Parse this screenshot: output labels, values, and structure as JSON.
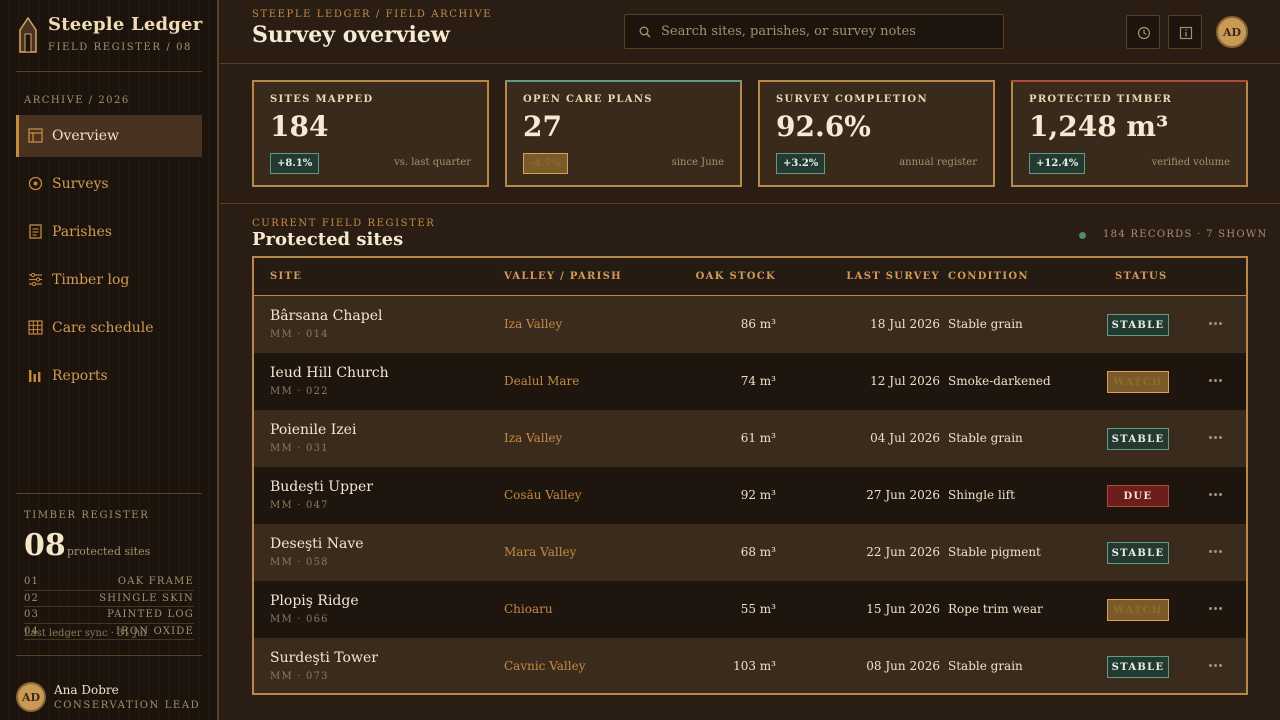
{
  "brand": {
    "name": "Steeple Ledger",
    "sub": "FIELD REGISTER / 08"
  },
  "nav": {
    "heading": "ARCHIVE / 2026",
    "items": [
      {
        "label": "Overview",
        "icon": "layout-icon",
        "active": true
      },
      {
        "label": "Surveys",
        "icon": "target-icon"
      },
      {
        "label": "Parishes",
        "icon": "document-icon"
      },
      {
        "label": "Timber log",
        "icon": "sliders-icon"
      },
      {
        "label": "Care schedule",
        "icon": "grid-icon"
      },
      {
        "label": "Reports",
        "icon": "bar-chart-icon"
      }
    ]
  },
  "register": {
    "heading": "TIMBER REGISTER",
    "count": "08",
    "count_label": "protected sites",
    "rows": [
      {
        "num": "01",
        "label": "OAK FRAME"
      },
      {
        "num": "02",
        "label": "SHINGLE SKIN"
      },
      {
        "num": "03",
        "label": "PAINTED LOG"
      },
      {
        "num": "04",
        "label": "IRON OXIDE"
      }
    ],
    "sync": "Last ledger sync · 31 Jul"
  },
  "user": {
    "initials": "AD",
    "name": "Ana Dobre",
    "role": "CONSERVATION LEAD"
  },
  "header": {
    "breadcrumb": "STEEPLE LEDGER / FIELD ARCHIVE",
    "title": "Survey overview",
    "search_placeholder": "Search sites, parishes, or survey notes",
    "avatar": "AD"
  },
  "metrics": [
    {
      "label": "SITES MAPPED",
      "value": "184",
      "delta": "+8.1%",
      "trend": "up",
      "note": "vs. last quarter",
      "accent": "#b8874a"
    },
    {
      "label": "OPEN CARE PLANS",
      "value": "27",
      "delta": "-4.7%",
      "trend": "down",
      "note": "since June",
      "accent": "#5f9a82"
    },
    {
      "label": "SURVEY COMPLETION",
      "value": "92.6%",
      "delta": "+3.2%",
      "trend": "up",
      "note": "annual register",
      "accent": "#b8874a"
    },
    {
      "label": "PROTECTED TIMBER",
      "value": "1,248 m³",
      "delta": "+12.4%",
      "trend": "up",
      "note": "verified volume",
      "accent": "#b04a3e"
    }
  ],
  "section": {
    "eyebrow": "CURRENT FIELD REGISTER",
    "title": "Protected sites",
    "count": "184 RECORDS · 7 SHOWN"
  },
  "table": {
    "columns": [
      "SITE",
      "VALLEY / PARISH",
      "OAK STOCK",
      "LAST SURVEY",
      "CONDITION",
      "STATUS"
    ],
    "rows": [
      {
        "site": "Bârsana Chapel",
        "code": "MM · 014",
        "valley": "Iza Valley",
        "oak": "86 m³",
        "survey": "18 Jul 2026",
        "condition": "Stable grain",
        "status": "STABLE"
      },
      {
        "site": "Ieud Hill Church",
        "code": "MM · 022",
        "valley": "Dealul Mare",
        "oak": "74 m³",
        "survey": "12 Jul 2026",
        "condition": "Smoke-darkened",
        "status": "WATCH"
      },
      {
        "site": "Poienile Izei",
        "code": "MM · 031",
        "valley": "Iza Valley",
        "oak": "61 m³",
        "survey": "04 Jul 2026",
        "condition": "Stable grain",
        "status": "STABLE"
      },
      {
        "site": "Budeşti Upper",
        "code": "MM · 047",
        "valley": "Cosău Valley",
        "oak": "92 m³",
        "survey": "27 Jun 2026",
        "condition": "Shingle lift",
        "status": "DUE"
      },
      {
        "site": "Deseşti Nave",
        "code": "MM · 058",
        "valley": "Mara Valley",
        "oak": "68 m³",
        "survey": "22 Jun 2026",
        "condition": "Stable pigment",
        "status": "STABLE"
      },
      {
        "site": "Plopiş Ridge",
        "code": "MM · 066",
        "valley": "Chioaru",
        "oak": "55 m³",
        "survey": "15 Jun 2026",
        "condition": "Rope trim wear",
        "status": "WATCH"
      },
      {
        "site": "Surdeşti Tower",
        "code": "MM · 073",
        "valley": "Cavnic Valley",
        "oak": "103 m³",
        "survey": "08 Jun 2026",
        "condition": "Stable grain",
        "status": "STABLE"
      }
    ]
  }
}
